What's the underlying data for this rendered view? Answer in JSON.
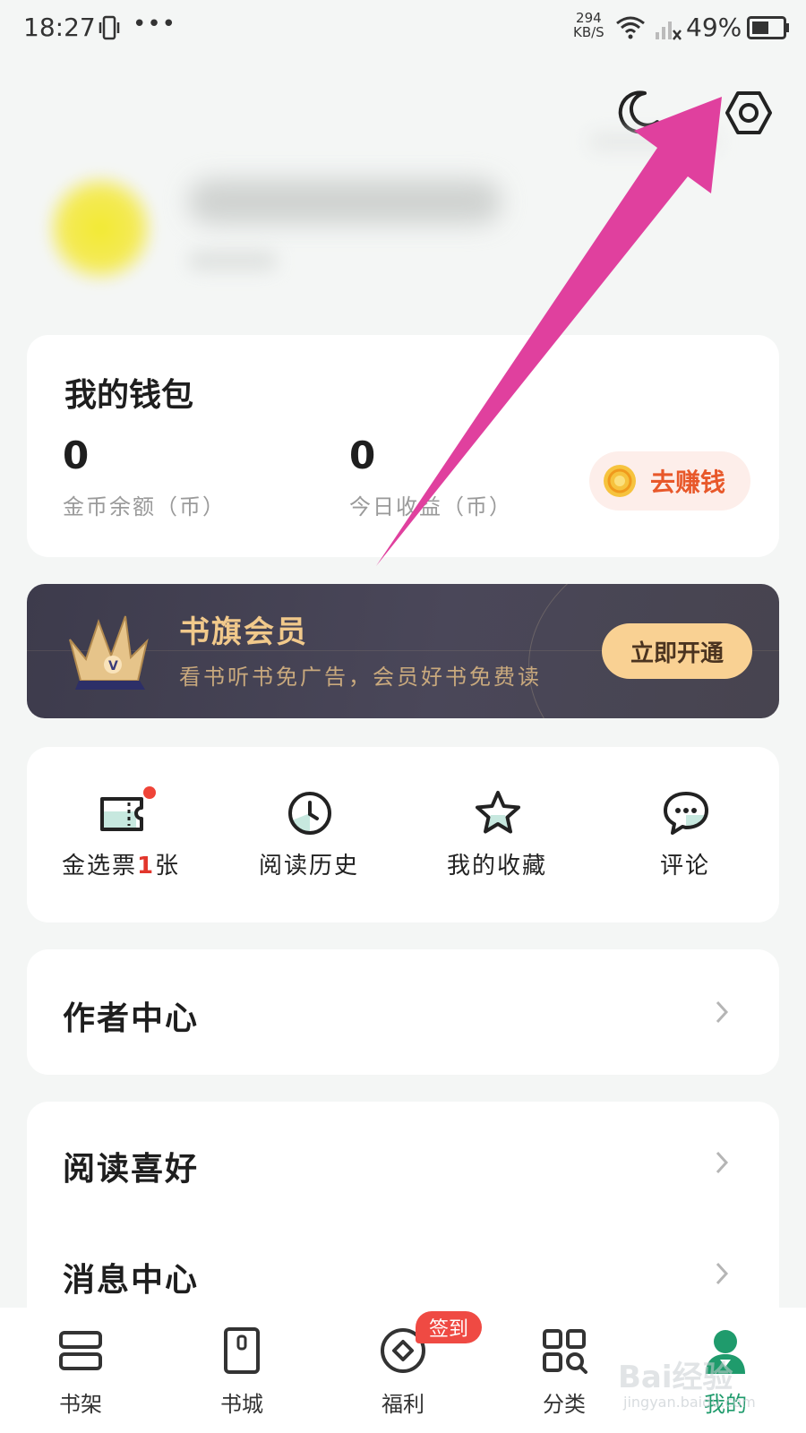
{
  "status_bar": {
    "time": "18:27",
    "more": "•••",
    "net_speed_value": "294",
    "net_speed_unit": "KB/S",
    "battery": "49%"
  },
  "header": {
    "moon_icon": "moon-icon",
    "settings_icon": "settings-icon"
  },
  "wallet": {
    "title": "我的钱包",
    "coin_balance_value": "0",
    "coin_balance_label": "金币余额（币）",
    "today_income_value": "0",
    "today_income_label": "今日收益（币）",
    "earn_button": "去赚钱"
  },
  "vip": {
    "title": "书旗会员",
    "description": "看书听书免广告，会员好书免费读",
    "button": "立即开通"
  },
  "quick_actions": [
    {
      "label_prefix": "金选票",
      "label_num": "1",
      "label_suffix": "张",
      "icon": "ticket-icon",
      "has_dot": true
    },
    {
      "label": "阅读历史",
      "icon": "clock-icon"
    },
    {
      "label": "我的收藏",
      "icon": "star-icon"
    },
    {
      "label": "评论",
      "icon": "comment-icon"
    }
  ],
  "menu": {
    "author_center": "作者中心",
    "reading_preference": "阅读喜好",
    "message_center": "消息中心"
  },
  "bottom_nav": [
    {
      "label": "书架",
      "icon": "bookshelf-icon"
    },
    {
      "label": "书城",
      "icon": "bookstore-icon"
    },
    {
      "label": "福利",
      "icon": "welfare-icon",
      "badge": "签到"
    },
    {
      "label": "分类",
      "icon": "category-icon"
    },
    {
      "label": "我的",
      "icon": "profile-icon",
      "active": true
    }
  ],
  "watermark": {
    "main": "Bai经验",
    "sub": "jingyan.baidu.com"
  },
  "colors": {
    "accent_green": "#1f9b6c",
    "earn_orange": "#e8582a",
    "vip_gold": "#f1c98b",
    "annotation_arrow": "#e0409e"
  }
}
